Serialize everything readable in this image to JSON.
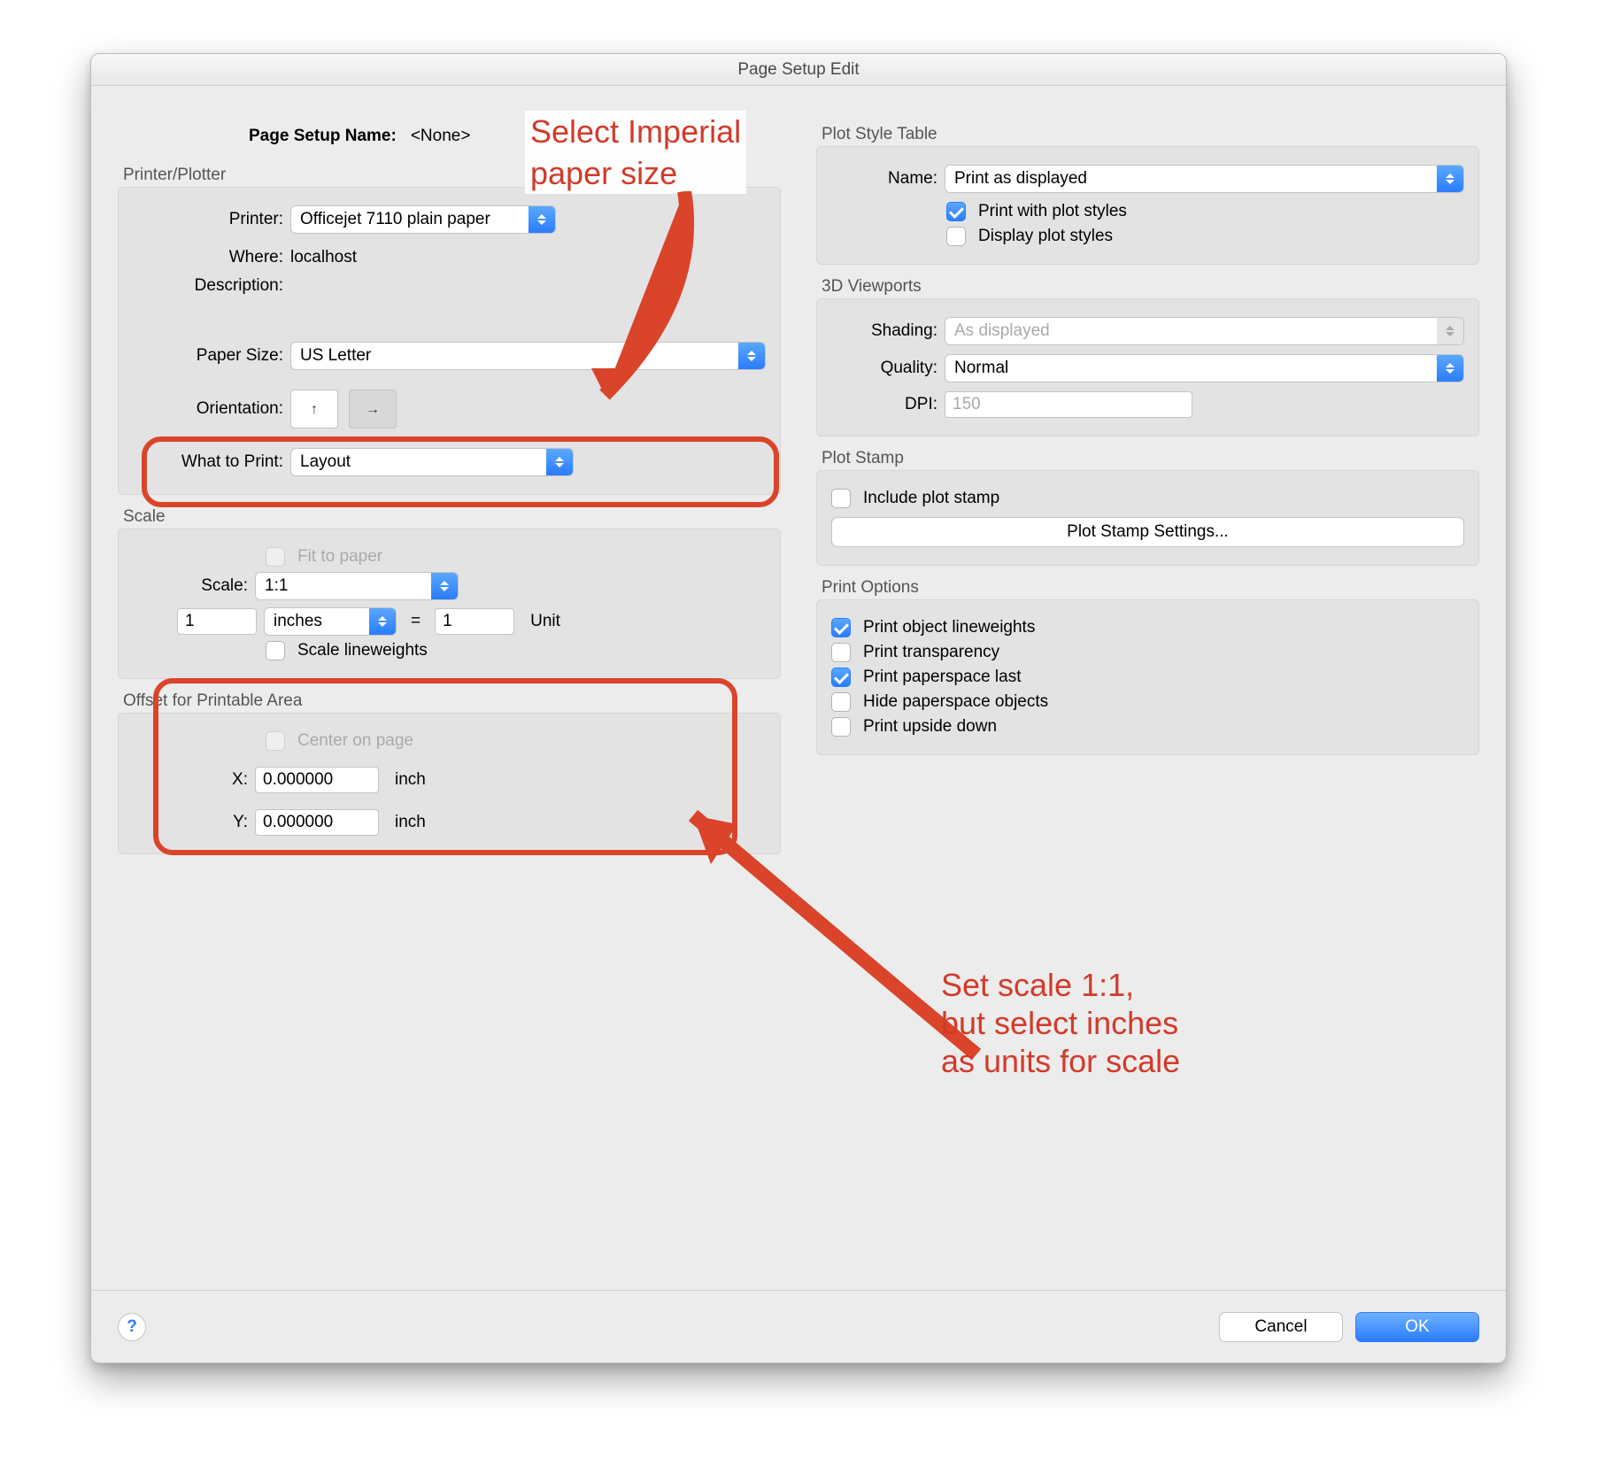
{
  "window": {
    "title": "Page Setup Edit"
  },
  "header": {
    "page_setup_name_label": "Page Setup Name:",
    "page_setup_name_value": "<None>"
  },
  "printer_plotter": {
    "group_title": "Printer/Plotter",
    "printer_label": "Printer:",
    "printer_value": "Officejet 7110 plain paper",
    "where_label": "Where:",
    "where_value": "localhost",
    "description_label": "Description:",
    "paper_size_label": "Paper Size:",
    "paper_size_value": "US Letter",
    "orientation_label": "Orientation:",
    "what_to_print_label": "What to Print:",
    "what_to_print_value": "Layout"
  },
  "scale": {
    "group_title": "Scale",
    "fit_to_paper_label": "Fit to paper",
    "scale_label": "Scale:",
    "scale_value": "1:1",
    "left_value": "1",
    "units_value": "inches",
    "equals": "=",
    "right_value": "1",
    "unit_label": "Unit",
    "scale_lineweights_label": "Scale lineweights"
  },
  "offset": {
    "group_title": "Offset for Printable Area",
    "center_label": "Center on page",
    "x_label": "X:",
    "x_value": "0.000000",
    "y_label": "Y:",
    "y_value": "0.000000",
    "unit": "inch"
  },
  "plot_style_table": {
    "group_title": "Plot Style Table",
    "name_label": "Name:",
    "name_value": "Print as displayed",
    "print_with_plot_styles": "Print with plot styles",
    "display_plot_styles": "Display plot styles"
  },
  "viewports_3d": {
    "group_title": "3D Viewports",
    "shading_label": "Shading:",
    "shading_value": "As displayed",
    "quality_label": "Quality:",
    "quality_value": "Normal",
    "dpi_label": "DPI:",
    "dpi_value": "150"
  },
  "plot_stamp": {
    "group_title": "Plot Stamp",
    "include_label": "Include plot stamp",
    "settings_button": "Plot Stamp Settings..."
  },
  "print_options": {
    "group_title": "Print Options",
    "o1": "Print object lineweights",
    "o2": "Print transparency",
    "o3": "Print paperspace last",
    "o4": "Hide paperspace objects",
    "o5": "Print upside down"
  },
  "footer": {
    "cancel": "Cancel",
    "ok": "OK",
    "help": "?"
  },
  "annotations": {
    "anno1_line1": "Select Imperial",
    "anno1_line2": "paper size",
    "anno2_line1": "Set scale 1:1,",
    "anno2_line2": "but select inches",
    "anno2_line3": "as units for scale"
  }
}
